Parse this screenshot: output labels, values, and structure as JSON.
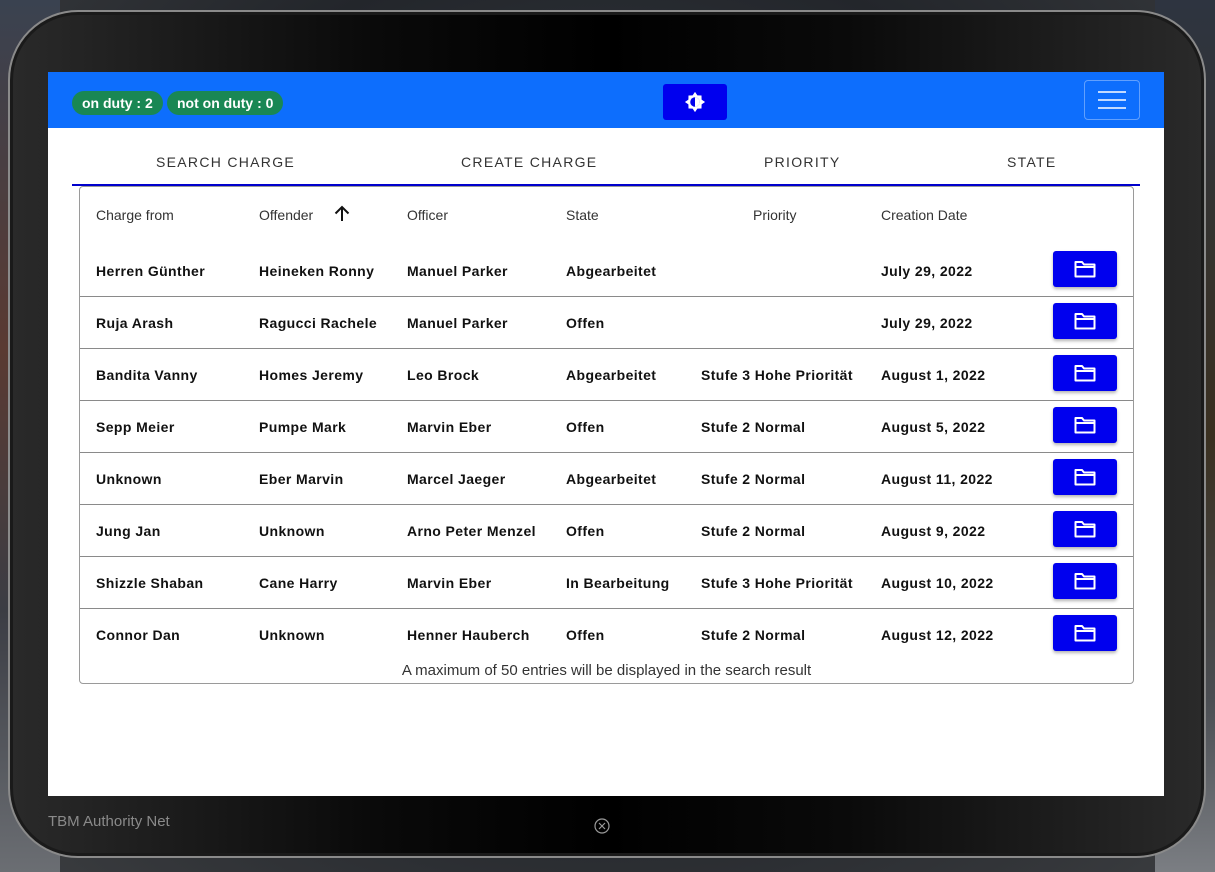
{
  "topbar": {
    "on_duty": "on duty : 2",
    "not_on_duty": "not on duty : 0",
    "accent_color": "#0d6efd",
    "badge_color": "#198754",
    "button_color": "#0000ee"
  },
  "tabs": [
    {
      "label": "SEARCH CHARGE"
    },
    {
      "label": "CREATE CHARGE"
    },
    {
      "label": "PRIORITY"
    },
    {
      "label": "STATE"
    }
  ],
  "table": {
    "headers": {
      "charge_from": "Charge from",
      "offender": "Offender",
      "officer": "Officer",
      "state": "State",
      "priority": "Priority",
      "creation_date": "Creation Date"
    },
    "sort_icon": "arrow-up-icon",
    "rows": [
      {
        "charge_from": "Herren Günther",
        "offender": "Heineken Ronny",
        "officer": "Manuel Parker",
        "state": "Abgearbeitet",
        "priority": "",
        "date": "July 29, 2022"
      },
      {
        "charge_from": "Ruja Arash",
        "offender": "Ragucci Rachele",
        "officer": "Manuel Parker",
        "state": "Offen",
        "priority": "",
        "date": "July 29, 2022"
      },
      {
        "charge_from": "Bandita Vanny",
        "offender": "Homes Jeremy",
        "officer": "Leo Brock",
        "state": "Abgearbeitet",
        "priority": "Stufe 3 Hohe Priorität",
        "date": "August 1, 2022"
      },
      {
        "charge_from": "Sepp Meier",
        "offender": "Pumpe Mark",
        "officer": "Marvin Eber",
        "state": "Offen",
        "priority": "Stufe 2 Normal",
        "date": "August 5, 2022"
      },
      {
        "charge_from": "Unknown",
        "offender": "Eber Marvin",
        "officer": "Marcel Jaeger",
        "state": "Abgearbeitet",
        "priority": "Stufe 2 Normal",
        "date": "August 11, 2022"
      },
      {
        "charge_from": "Jung Jan",
        "offender": "Unknown",
        "officer": "Arno Peter Menzel",
        "state": "Offen",
        "priority": "Stufe 2 Normal",
        "date": "August 9, 2022"
      },
      {
        "charge_from": "Shizzle Shaban",
        "offender": "Cane Harry",
        "officer": "Marvin Eber",
        "state": "In Bearbeitung",
        "priority": "Stufe 3 Hohe Priorität",
        "date": "August 10, 2022"
      },
      {
        "charge_from": "Connor Dan",
        "offender": "Unknown",
        "officer": "Henner Hauberch",
        "state": "Offen",
        "priority": "Stufe 2 Normal",
        "date": "August 12, 2022"
      }
    ],
    "row_action_icon": "folder-icon",
    "footer_note": "A maximum of 50 entries will be displayed in the search result"
  },
  "device": {
    "brand": "TBM Authority Net",
    "close_icon": "close-circle-icon"
  }
}
